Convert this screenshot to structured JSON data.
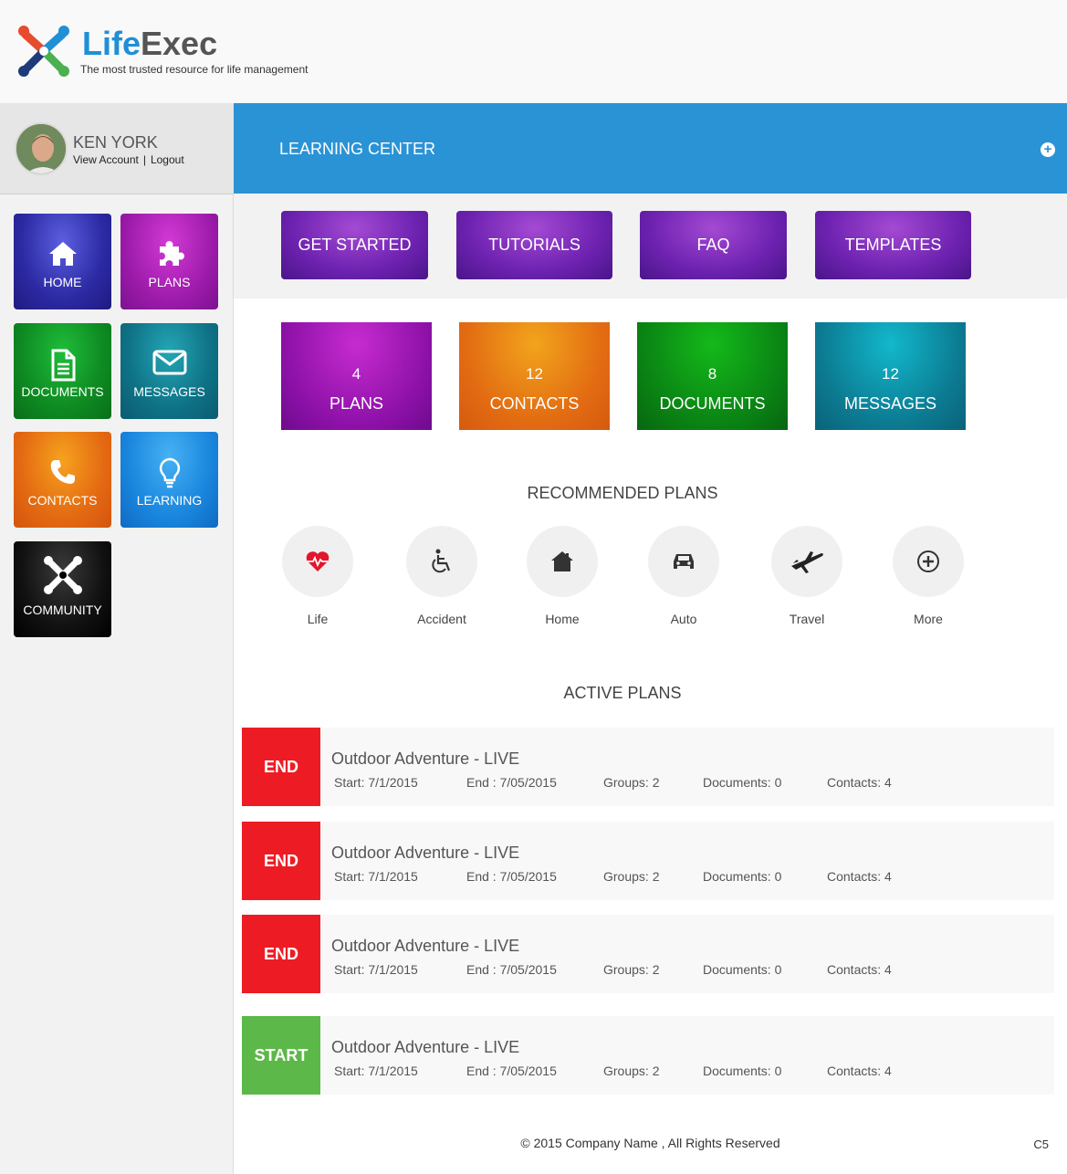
{
  "brand": {
    "name_part1": "Life",
    "name_part2": "Exec",
    "tagline": "The most trusted resource for life management",
    "colors": {
      "blue": "#1f8fd6",
      "gray": "#555555",
      "red": "#e64c2e",
      "green": "#4caf50",
      "navy": "#1e3a7a"
    }
  },
  "user": {
    "name": "KEN YORK",
    "view_account": "View Account",
    "separator": "|",
    "logout": "Logout"
  },
  "sidebar": {
    "items": [
      {
        "label": "HOME",
        "icon": "home-icon",
        "color": "#2c2aa3"
      },
      {
        "label": "PLANS",
        "icon": "puzzle-icon",
        "color": "#9a1aa8"
      },
      {
        "label": "DOCUMENTS",
        "icon": "document-icon",
        "color": "#0e8a22"
      },
      {
        "label": "MESSAGES",
        "icon": "envelope-icon",
        "color": "#0f7286"
      },
      {
        "label": "CONTACTS",
        "icon": "phone-icon",
        "color": "#e46a12"
      },
      {
        "label": "LEARNING",
        "icon": "lightbulb-icon",
        "color": "#1a86dd"
      },
      {
        "label": "COMMUNITY",
        "icon": "community-icon",
        "color": "#000000"
      }
    ]
  },
  "banner": {
    "title": "LEARNING CENTER",
    "action_icon": "plus-circle-icon",
    "color": "#2a93d5"
  },
  "learning_buttons": [
    "GET STARTED",
    "TUTORIALS",
    "FAQ",
    "TEMPLATES"
  ],
  "stats": [
    {
      "count": "4",
      "label": "PLANS",
      "color": "#8a10a6"
    },
    {
      "count": "12",
      "label": "CONTACTS",
      "color": "#e26b12"
    },
    {
      "count": "8",
      "label": "DOCUMENTS",
      "color": "#0a8414"
    },
    {
      "count": "12",
      "label": "MESSAGES",
      "color": "#0c7b92"
    }
  ],
  "recommended": {
    "title": "RECOMMENDED PLANS",
    "items": [
      {
        "label": "Life",
        "icon": "heartbeat-icon"
      },
      {
        "label": "Accident",
        "icon": "wheelchair-icon"
      },
      {
        "label": "Home",
        "icon": "house-icon"
      },
      {
        "label": "Auto",
        "icon": "car-icon"
      },
      {
        "label": "Travel",
        "icon": "airplane-icon"
      },
      {
        "label": "More",
        "icon": "plus-circle-icon"
      }
    ]
  },
  "active_plans": {
    "title": "ACTIVE PLANS",
    "rows": [
      {
        "status": "END",
        "title": "Outdoor Adventure - LIVE",
        "start": "Start: 7/1/2015",
        "end": "End : 7/05/2015",
        "groups": "Groups: 2",
        "documents": "Documents: 0",
        "contacts": "Contacts: 4"
      },
      {
        "status": "END",
        "title": "Outdoor Adventure - LIVE",
        "start": "Start: 7/1/2015",
        "end": "End : 7/05/2015",
        "groups": "Groups: 2",
        "documents": "Documents: 0",
        "contacts": "Contacts: 4"
      },
      {
        "status": "END",
        "title": "Outdoor Adventure - LIVE",
        "start": "Start: 7/1/2015",
        "end": "End : 7/05/2015",
        "groups": "Groups: 2",
        "documents": "Documents: 0",
        "contacts": "Contacts: 4"
      },
      {
        "status": "START",
        "title": "Outdoor Adventure - LIVE",
        "start": "Start: 7/1/2015",
        "end": "End : 7/05/2015",
        "groups": "Groups: 2",
        "documents": "Documents: 0",
        "contacts": "Contacts: 4"
      }
    ],
    "status_colors": {
      "END": "#ed1c24",
      "START": "#5cb848"
    }
  },
  "footer": {
    "copyright": "© 2015 Company Name , All Rights Reserved",
    "code": "C5"
  }
}
